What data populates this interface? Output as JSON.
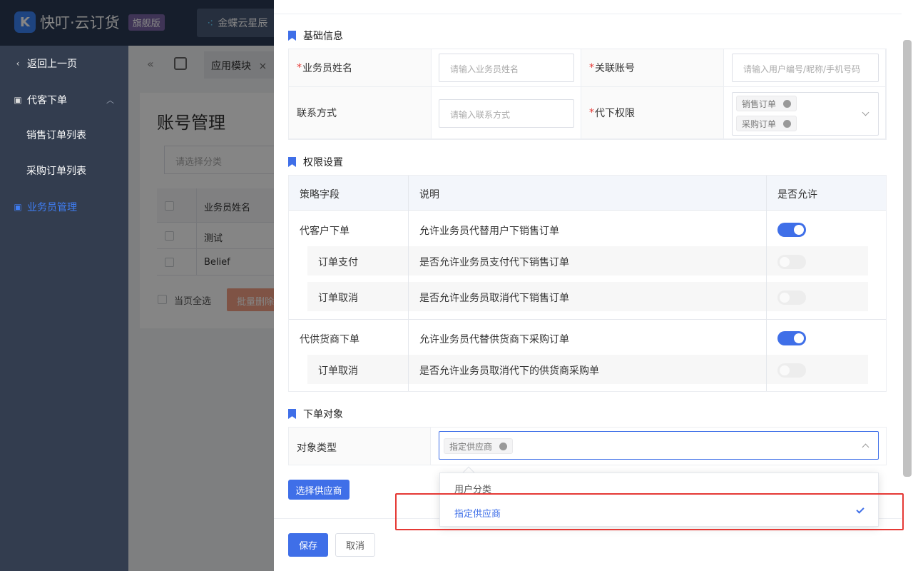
{
  "app": {
    "logo_mark": "K",
    "name": "快叮·云订货",
    "badge": "旗舰版",
    "partner": "金蝶云星辰"
  },
  "sidebar": {
    "back": "返回上一页",
    "group": "代客下单",
    "items": [
      "销售订单列表",
      "采购订单列表"
    ],
    "active": "业务员管理"
  },
  "tabs": {
    "current": "应用模块",
    "close": "×"
  },
  "list_page": {
    "title": "账号管理",
    "category_placeholder": "请选择分类",
    "column_name": "业务员姓名",
    "rows": [
      "测试",
      "Belief"
    ],
    "select_all": "当页全选",
    "bulk_delete": "批量删除"
  },
  "drawer": {
    "basic": {
      "title": "基础信息",
      "name_label": "业务员姓名",
      "name_placeholder": "请输入业务员姓名",
      "account_label": "关联账号",
      "account_placeholder": "请输入用户编号/昵称/手机号码",
      "contact_label": "联系方式",
      "contact_placeholder": "请输入联系方式",
      "perm_label": "代下权限",
      "perm_tags": [
        "销售订单",
        "采购订单"
      ]
    },
    "permissions": {
      "title": "权限设置",
      "headers": [
        "策略字段",
        "说明",
        "是否允许"
      ],
      "rows": [
        {
          "field": "代客户下单",
          "desc": "允许业务员代替用户下销售订单",
          "allowed": true
        },
        {
          "field": "订单支付",
          "desc": "是否允许业务员支付代下销售订单",
          "allowed": false
        },
        {
          "field": "订单取消",
          "desc": "是否允许业务员取消代下销售订单",
          "allowed": false
        },
        {
          "field": "代供货商下单",
          "desc": "允许业务员代替供货商下采购订单",
          "allowed": true
        },
        {
          "field": "订单取消",
          "desc": "是否允许业务员取消代下的供货商采购单",
          "allowed": false
        }
      ]
    },
    "target": {
      "title": "下单对象",
      "type_label": "对象类型",
      "selected_tag": "指定供应商",
      "options": [
        "用户分类",
        "指定供应商"
      ],
      "select_supplier_button": "选择供应商"
    },
    "footer": {
      "save": "保存",
      "cancel": "取消"
    }
  },
  "colors": {
    "primary": "#3f6fe8",
    "sidebar": "#333d4f",
    "highlight": "#e53935"
  }
}
